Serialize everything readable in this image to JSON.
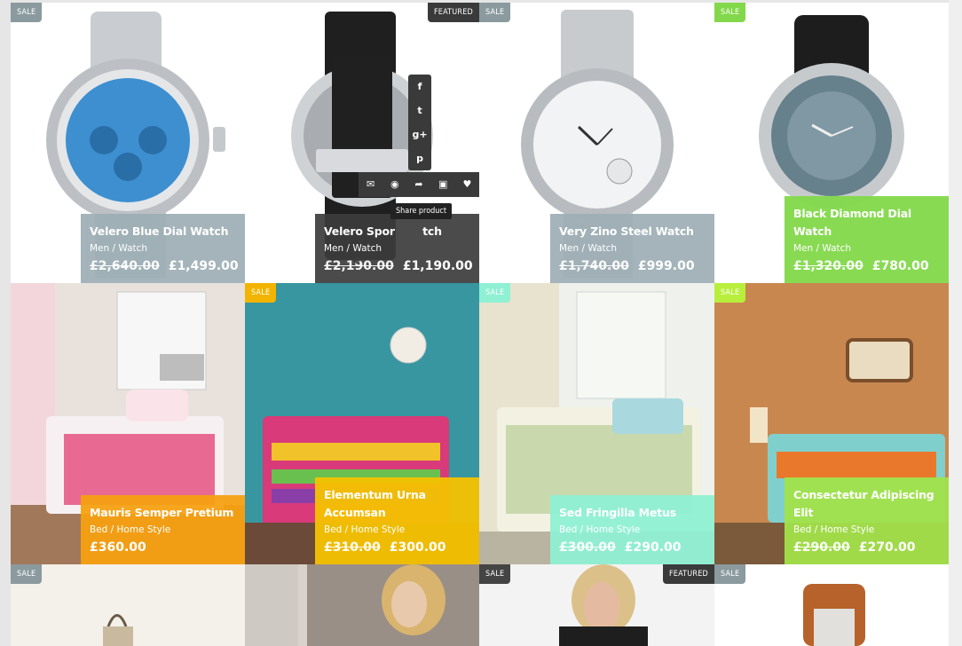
{
  "colors": {
    "sale_grey": "#8a9a9e",
    "sale_dark": "#444444",
    "sale_green": "#82d84a",
    "sale_yellow": "#f2b400",
    "sale_mint": "#8ff0d3",
    "sale_lime": "#b8ef3c",
    "featured": "#3a3a3a",
    "panel_grey": "#9caeb4",
    "panel_dark": "#3c3c3c",
    "panel_green": "#82d84a",
    "panel_orange": "#f5a012",
    "panel_yellow": "#f5c200",
    "panel_mint": "#8ff0d3",
    "panel_lime": "#a2e24a"
  },
  "badges": {
    "sale": "SALE",
    "featured": "FEATURED"
  },
  "products": [
    {
      "name": "Velero Blue Dial Watch",
      "category": "Men / Watch",
      "old_price": "£2,640.00",
      "price": "£1,499.00"
    },
    {
      "name": "Velero Spor",
      "name_tail": "tch",
      "category": "Men / Watch",
      "old_price": "£2,190.00",
      "price": "£1,190.00"
    },
    {
      "name": "Very Zino Steel Watch",
      "category": "Men / Watch",
      "old_price": "£1,740.00",
      "price": "£999.00"
    },
    {
      "name": "Black Diamond Dial Watch",
      "category": "Men / Watch",
      "old_price": "£1,320.00",
      "price": "£780.00"
    },
    {
      "name": "Mauris Semper Pretium",
      "category": "Bed / Home Style",
      "price": "£360.00"
    },
    {
      "name": "Elementum Urna Accumsan",
      "category": "Bed / Home Style",
      "old_price": "£310.00",
      "price": "£300.00"
    },
    {
      "name": "Sed Fringilla Metus",
      "category": "Bed / Home Style",
      "old_price": "£300.00",
      "price": "£290.00"
    },
    {
      "name": "Consectetur Adipiscing Elit",
      "category": "Bed / Home Style",
      "old_price": "£290.00",
      "price": "£270.00"
    }
  ],
  "social_icons": [
    "f",
    "t",
    "g+",
    "p"
  ],
  "action_icons": [
    "envelope-icon",
    "eye-icon",
    "share-icon",
    "cart-icon",
    "heart-icon"
  ],
  "tooltip": "Share product"
}
